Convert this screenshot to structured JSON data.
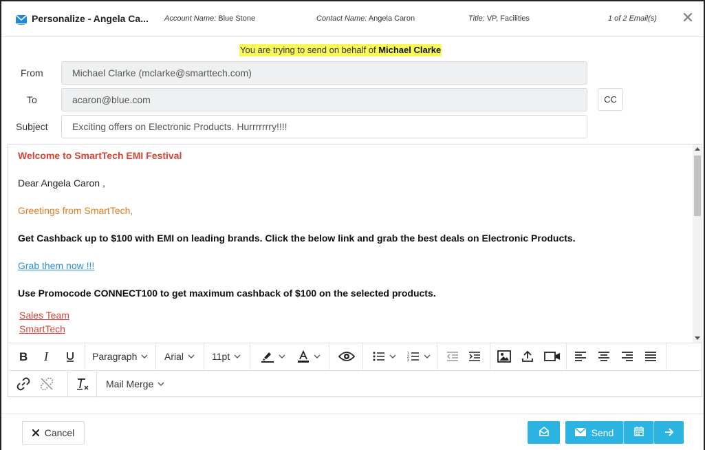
{
  "header": {
    "title": "Personalize - Angela Ca...",
    "account_label": "Account Name:",
    "account_value": "Blue Stone",
    "contact_label": "Contact Name:",
    "contact_value": "Angela Caron",
    "title_label": "Title:",
    "title_value": "VP, Facilities",
    "count": "1 of 2 Email(s)"
  },
  "notice": {
    "prefix": "You are trying to send on behalf of",
    "name": "Michael Clarke"
  },
  "form": {
    "from_label": "From",
    "from_value": "Michael Clarke (mclarke@smarttech.com)",
    "to_label": "To",
    "to_value": "acaron@blue.com",
    "cc_label": "CC",
    "subject_label": "Subject",
    "subject_value": "Exciting offers on Electronic Products. Hurrrrrrry!!!!"
  },
  "body": {
    "welcome": "Welcome to SmartTech EMI Festival",
    "dear": "Dear Angela Caron ,",
    "greeting": "Greetings from SmartTech,",
    "cashback": "Get Cashback up to $100 with EMI on leading brands. Click the below link and grab the best deals on Electronic Products.",
    "link": "Grab them now !!! ",
    "promo": "Use Promocode CONNECT100 to get maximum cashback of $100 on the selected products.",
    "sig1": "Sales Team",
    "sig2": "SmartTech"
  },
  "toolbar": {
    "paragraph": "Paragraph",
    "font": "Arial",
    "size": "11pt",
    "mail_merge": "Mail Merge"
  },
  "footer": {
    "cancel": "Cancel",
    "send": "Send"
  },
  "colors": {
    "accent": "#2bb3e2",
    "highlight": "#f9f95a",
    "welcome_red": "#d64236",
    "greeting_orange": "#e07b22",
    "link_blue": "#2f8fd8"
  }
}
